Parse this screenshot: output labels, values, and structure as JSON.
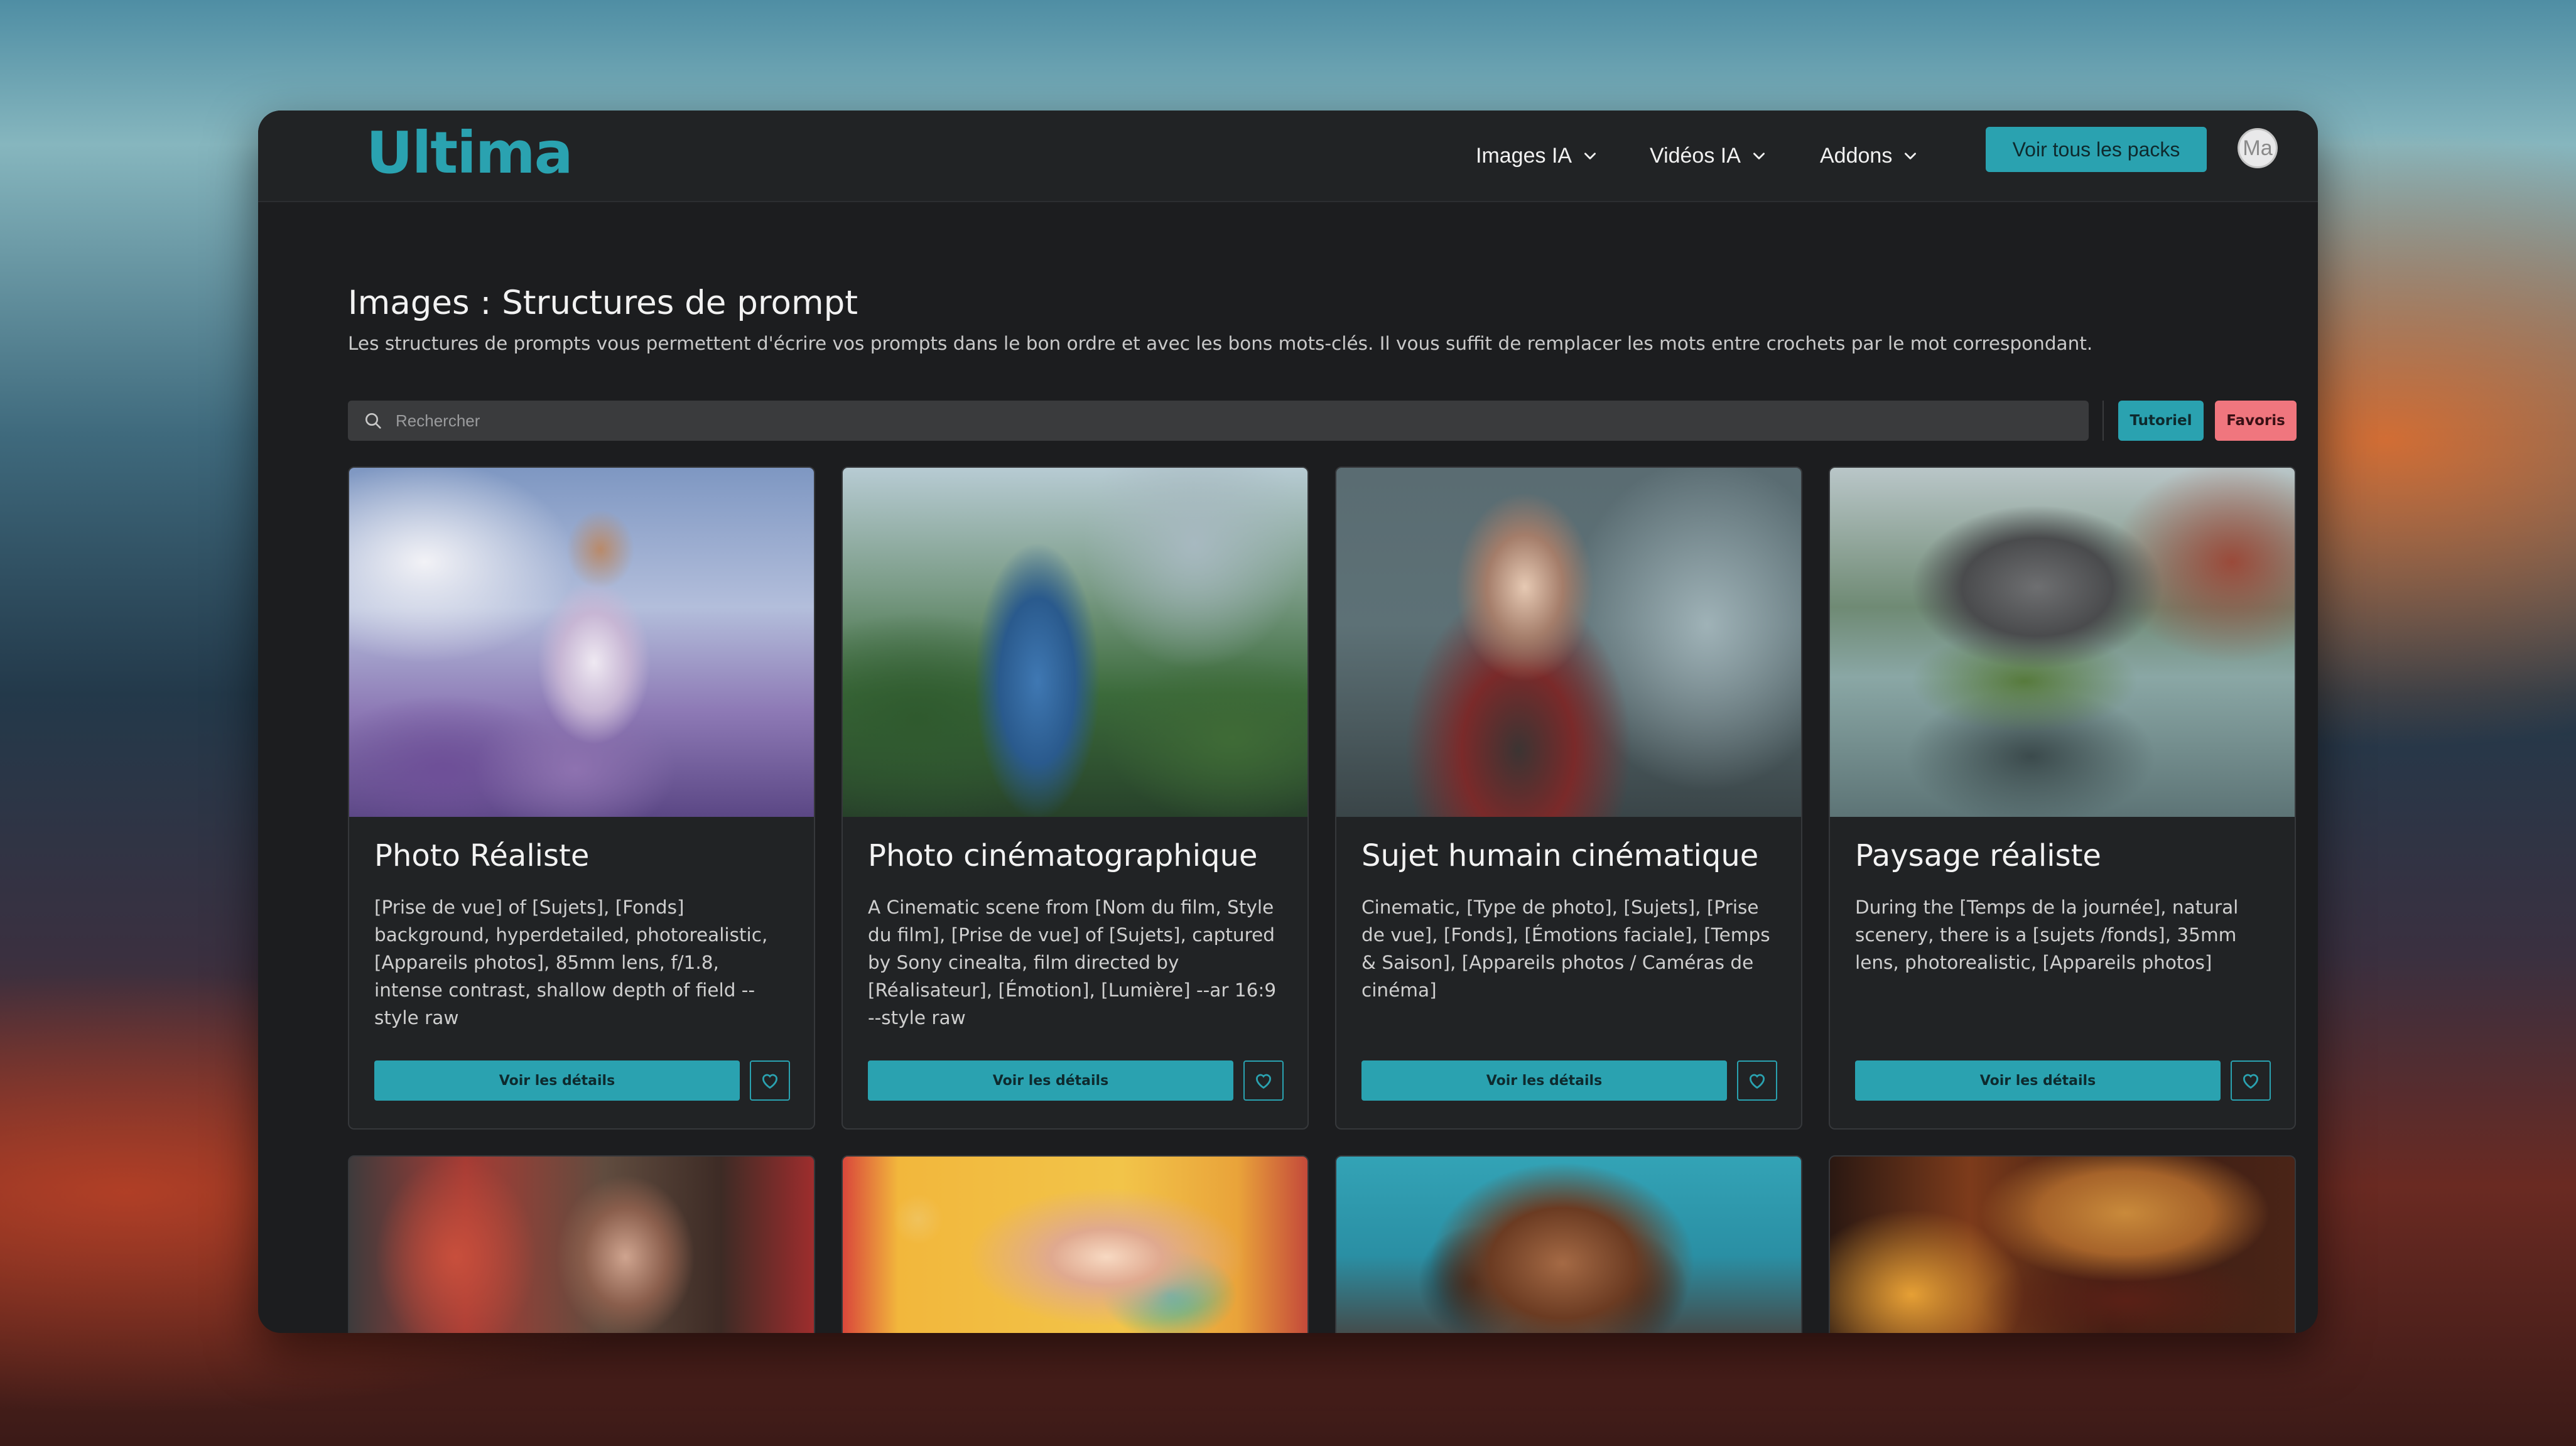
{
  "nav": {
    "logo": "Ultima",
    "menu": [
      {
        "label": "Images IA"
      },
      {
        "label": "Vidéos IA"
      },
      {
        "label": "Addons"
      }
    ],
    "cta_label": "Voir tous les packs",
    "avatar_text": "Ma"
  },
  "page": {
    "title": "Images : Structures de prompt",
    "description": "Les structures de prompts vous permettent d'écrire vos prompts dans le bon ordre et avec les bons mots-clés. Il vous suffit de remplacer les mots entre crochets par le mot correspondant."
  },
  "search": {
    "placeholder": "Rechercher",
    "value": ""
  },
  "filters": {
    "tutorial_label": "Tutoriel",
    "favorites_label": "Favoris"
  },
  "cards": [
    {
      "title": "Photo Réaliste",
      "text": "[Prise de vue] of [Sujets], [Fonds] background, hyperdetailed, photorealistic, [Appareils photos], 85mm lens, f/1.8, intense contrast, shallow depth of field --style raw",
      "button_label": "Voir les détails"
    },
    {
      "title": "Photo cinématographique",
      "text": "A Cinematic scene from [Nom du film, Style du film], [Prise de vue] of [Sujets], captured by Sony cinealta, film directed by [Réalisateur], [Émotion], [Lumière] --ar 16:9 --style raw",
      "button_label": "Voir les détails"
    },
    {
      "title": "Sujet humain cinématique",
      "text": "Cinematic, [Type de photo], [Sujets], [Prise de vue], [Fonds], [Émotions faciale], [Temps & Saison], [Appareils photos / Caméras de cinéma]",
      "button_label": "Voir les détails"
    },
    {
      "title": "Paysage réaliste",
      "text": "During the [Temps de la journée], natural scenery, there is a [sujets /fonds], 35mm lens, photorealistic, [Appareils photos]",
      "button_label": "Voir les détails"
    }
  ],
  "colors": {
    "accent": "#2aa2b0",
    "favorites": "#f0767e",
    "background": "#1c1d1f"
  }
}
